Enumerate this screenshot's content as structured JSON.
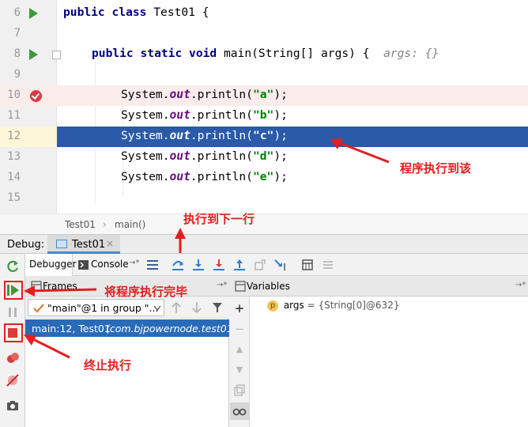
{
  "editor": {
    "lines": [
      {
        "num": "6",
        "text": "public class Test01 {"
      },
      {
        "num": "7",
        "text": ""
      },
      {
        "num": "8",
        "text": "public static void main(String[] args) {",
        "hint": "args: {}"
      },
      {
        "num": "9",
        "text": ""
      },
      {
        "num": "10",
        "obj": "System.",
        "field": "out",
        "call": ".println(",
        "str": "\"a\"",
        "end": ");"
      },
      {
        "num": "11",
        "obj": "System.",
        "field": "out",
        "call": ".println(",
        "str": "\"b\"",
        "end": ");"
      },
      {
        "num": "12",
        "obj": "System.",
        "field": "out",
        "call": ".println(",
        "str": "\"c\"",
        "end": ");"
      },
      {
        "num": "13",
        "obj": "System.",
        "field": "out",
        "call": ".println(",
        "str": "\"d\"",
        "end": ");"
      },
      {
        "num": "14",
        "obj": "System.",
        "field": "out",
        "call": ".println(",
        "str": "\"e\"",
        "end": ");"
      },
      {
        "num": "15",
        "text": ""
      }
    ],
    "keywords": {
      "public": "public",
      "class": "class",
      "static": "static",
      "void": "void"
    },
    "class_rest": "Test01 {",
    "main_rest": "main(String[] args) {"
  },
  "breadcrumb": {
    "class": "Test01",
    "sep": "›",
    "method": "main()"
  },
  "debug": {
    "label": "Debug:",
    "tab": "Test01",
    "tab_close": "×",
    "debugger_tab": "Debugger",
    "console_tab": "Console",
    "console_arrow": "→*"
  },
  "frames": {
    "title": "Frames",
    "pin": "→*",
    "thread": "\"main\"@1 in group \"...",
    "selected_frame": "main:12, Test01",
    "selected_package": "(com.bjpowernode.test01)"
  },
  "variables": {
    "title": "Variables",
    "pin": "→*",
    "badge": "p",
    "name": "args",
    "value": "= {String[0]@632}"
  },
  "annotations": {
    "exec_here": "程序执行到该",
    "step_over": "执行到下一行",
    "resume": "将程序执行完毕",
    "stop": "终止执行"
  },
  "colors": {
    "selection": "#2a5aa8",
    "breakpoint_line": "#fbecec",
    "annotation": "#e02020",
    "run_green": "#3b9a3b"
  }
}
